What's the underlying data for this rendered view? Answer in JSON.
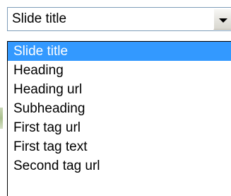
{
  "select": {
    "value": "Slide title"
  },
  "icons": {
    "dropdown": "chevron-down-icon"
  },
  "colors": {
    "highlight": "#3399ff",
    "border": "#7f9db9"
  },
  "options": [
    {
      "label": "Slide title",
      "selected": true
    },
    {
      "label": "Heading",
      "selected": false
    },
    {
      "label": "Heading url",
      "selected": false
    },
    {
      "label": "Subheading",
      "selected": false
    },
    {
      "label": "First tag url",
      "selected": false
    },
    {
      "label": "First tag text",
      "selected": false
    },
    {
      "label": "Second tag url",
      "selected": false
    }
  ]
}
